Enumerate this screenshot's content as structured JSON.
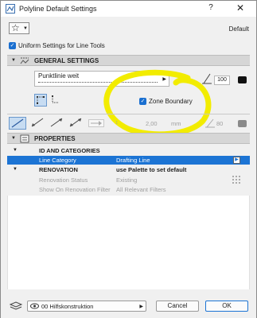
{
  "window": {
    "title": "Polyline Default Settings",
    "help": "?",
    "close": "✕"
  },
  "top": {
    "fav_icon": "star-icon",
    "preset_name": "Default",
    "uniform_label": "Uniform Settings for Line Tools"
  },
  "general": {
    "header": "GENERAL SETTINGS",
    "linetype_name": "Punktlinie weit",
    "pen_number": "100",
    "zone_boundary_label": "Zone Boundary",
    "arrow_size": "2,00",
    "arrow_unit": "mm",
    "arrow_pen": "80"
  },
  "properties": {
    "header": "PROPERTIES",
    "rows": [
      {
        "name": "ID AND CATEGORIES",
        "value": ""
      },
      {
        "name": "Line Category",
        "value": "Drafting Line"
      },
      {
        "name": "RENOVATION",
        "value": "use Palette to set default"
      },
      {
        "name": "Renovation Status",
        "value": "Existing"
      },
      {
        "name": "Show On Renovation Filter",
        "value": "All Relevant Filters"
      }
    ]
  },
  "bottom": {
    "layer_name": "00 Hilfskonstruktion",
    "cancel": "Cancel",
    "ok": "OK"
  },
  "colors": {
    "accent": "#1c74d4",
    "annotation": "#f2ec00"
  }
}
